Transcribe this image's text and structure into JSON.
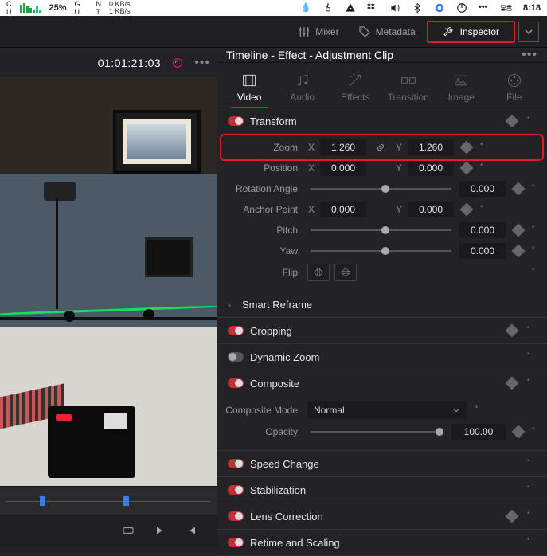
{
  "menubar": {
    "cpu_pct": "25%",
    "net_down": "0 KB/s",
    "net_up": "1 KB/s",
    "time": "8:18"
  },
  "topbar": {
    "mixer": "Mixer",
    "metadata": "Metadata",
    "inspector": "Inspector"
  },
  "left": {
    "timecode": "01:01:21:03"
  },
  "header": {
    "title": "Timeline - Effect - Adjustment Clip"
  },
  "tabs": {
    "video": "Video",
    "audio": "Audio",
    "effects": "Effects",
    "transition": "Transition",
    "image": "Image",
    "file": "File"
  },
  "transform": {
    "title": "Transform",
    "zoom_label": "Zoom",
    "zoom_x": "1.260",
    "zoom_y": "1.260",
    "position_label": "Position",
    "position_x": "0.000",
    "position_y": "0.000",
    "rotation_label": "Rotation Angle",
    "rotation_val": "0.000",
    "anchor_label": "Anchor Point",
    "anchor_x": "0.000",
    "anchor_y": "0.000",
    "pitch_label": "Pitch",
    "pitch_val": "0.000",
    "yaw_label": "Yaw",
    "yaw_val": "0.000",
    "flip_label": "Flip",
    "axis_x": "X",
    "axis_y": "Y"
  },
  "smart_reframe": {
    "title": "Smart Reframe"
  },
  "cropping": {
    "title": "Cropping"
  },
  "dynamic_zoom": {
    "title": "Dynamic Zoom"
  },
  "composite": {
    "title": "Composite",
    "mode_label": "Composite Mode",
    "mode_value": "Normal",
    "opacity_label": "Opacity",
    "opacity_value": "100.00"
  },
  "speed_change": {
    "title": "Speed Change"
  },
  "stabilization": {
    "title": "Stabilization"
  },
  "lens_correction": {
    "title": "Lens Correction"
  },
  "retime": {
    "title": "Retime and Scaling"
  }
}
